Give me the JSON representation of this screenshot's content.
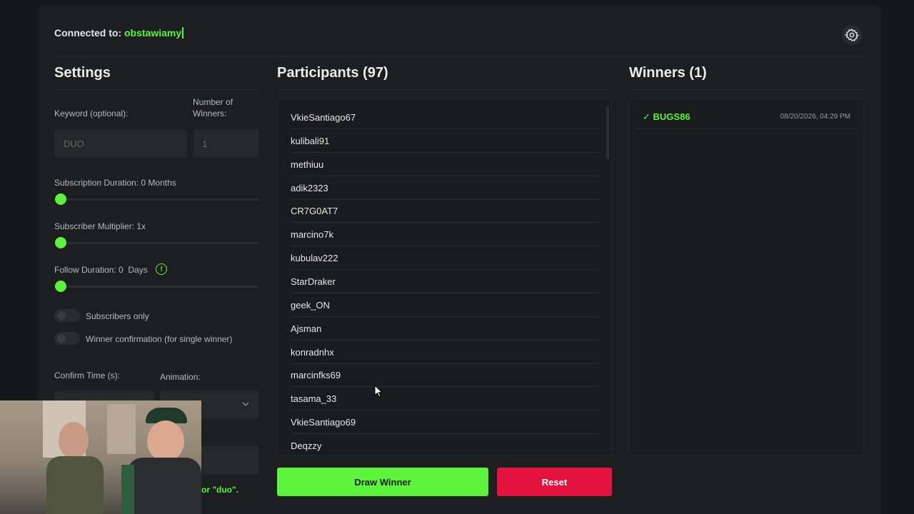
{
  "header": {
    "connected_label": "Connected to:",
    "channel": "obstawiamy"
  },
  "icons": {
    "settings": "gear-icon",
    "info": "info-icon",
    "check": "check-icon",
    "select": "chevron-down-icon"
  },
  "colors": {
    "accent": "#5df23b",
    "danger": "#e3123f",
    "background": "#1d1e20"
  },
  "settings": {
    "title": "Settings",
    "keyword_label": "Keyword (optional):",
    "keyword_placeholder": "DUO",
    "winners_label": "Number of Winners:",
    "winners_value": "1",
    "subscription_duration": "Subscription Duration: 0 Months",
    "subscriber_multiplier": "Subscriber Multiplier: 1x",
    "follow_duration": "Follow Duration: 0  Days",
    "follow_info_glyph": "!",
    "subscribers_only": "Subscribers only",
    "winner_confirmation": "Winner confirmation (for single winner)",
    "confirm_time_label": "Confirm Time (s):",
    "animation_label": "Animation:",
    "partial_note": "or \"duo\"."
  },
  "participants": {
    "title": "Participants (97)",
    "items": [
      "VkieSantiago67",
      "kulibali91",
      "methiuu",
      "adik2323",
      "CR7G0AT7",
      "marcino7k",
      "kubulav222",
      "StarDraker",
      "geek_ON",
      "Ajsman",
      "konradnhx",
      "marcinfks69",
      "tasama_33",
      "VkieSantiago69",
      "Deqzzy"
    ]
  },
  "winners": {
    "title": "Winners (1)",
    "items": [
      {
        "name": "BUGS86",
        "check": "✓",
        "date": "08/20/2026, 04:29 PM"
      }
    ]
  },
  "actions": {
    "draw": "Draw Winner",
    "reset": "Reset"
  }
}
